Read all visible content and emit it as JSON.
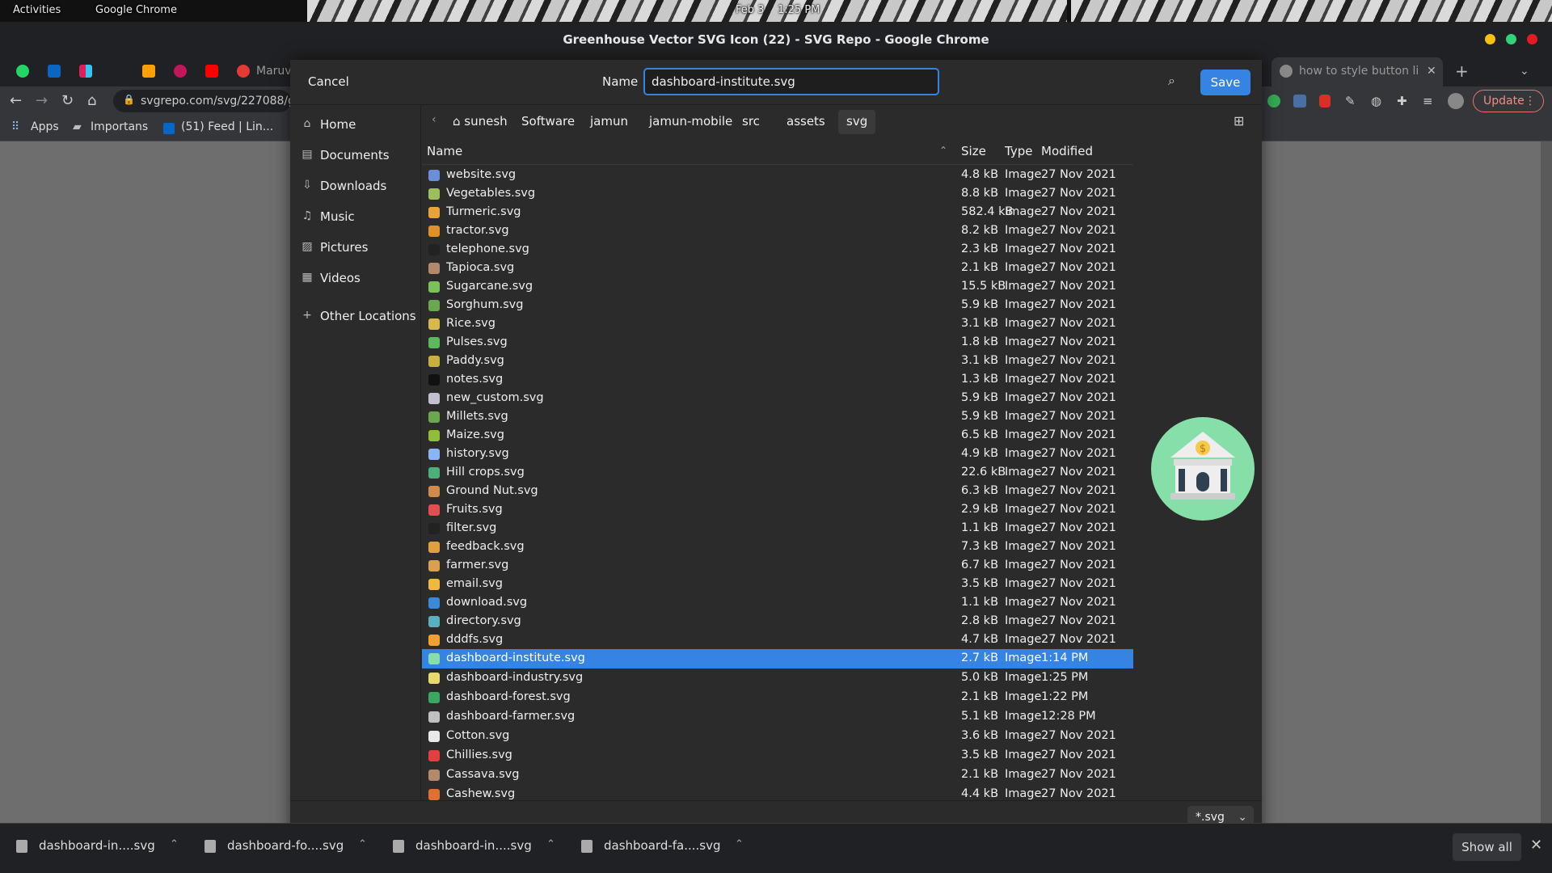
{
  "topbar": {
    "activities": "Activities",
    "app_name": "Google Chrome",
    "clock": "Feb 3",
    "clock_time": "1:25 PM"
  },
  "window": {
    "title": "Greenhouse Vector SVG Icon (22) - SVG Repo - Google Chrome"
  },
  "tabs": {
    "left_tab_text": "Maruv",
    "right_tab_text": "how to style button li",
    "new_tab": "+",
    "close": "✕"
  },
  "toolbar": {
    "url": "svgrepo.com/svg/227088/gre",
    "update_label": "Update"
  },
  "bookmarks": {
    "apps": "Apps",
    "important": "Importans",
    "feed": "(51) Feed | Lin..."
  },
  "dialog": {
    "cancel_label": "Cancel",
    "name_label": "Name",
    "name_value": "dashboard-institute.svg",
    "save_label": "Save",
    "sidebar": [
      {
        "icon": "home-icon",
        "glyph": "⌂",
        "label": "Home"
      },
      {
        "icon": "documents-icon",
        "glyph": "▤",
        "label": "Documents"
      },
      {
        "icon": "downloads-icon",
        "glyph": "⇩",
        "label": "Downloads"
      },
      {
        "icon": "music-icon",
        "glyph": "♫",
        "label": "Music"
      },
      {
        "icon": "pictures-icon",
        "glyph": "▨",
        "label": "Pictures"
      },
      {
        "icon": "videos-icon",
        "glyph": "▦",
        "label": "Videos"
      },
      {
        "icon": "other-locations-icon",
        "glyph": "+",
        "label": "Other Locations"
      }
    ],
    "path": [
      "sunesh",
      "Software",
      "jamun",
      "jamun-mobile",
      "src",
      "assets",
      "svg"
    ],
    "columns": {
      "name": "Name",
      "size": "Size",
      "type": "Type",
      "modified": "Modified"
    },
    "files": [
      {
        "name": "website.svg",
        "size": "4.8 kB",
        "type": "Image",
        "modified": "27 Nov 2021",
        "color": "#6a8fd8"
      },
      {
        "name": "Vegetables.svg",
        "size": "8.8 kB",
        "type": "Image",
        "modified": "27 Nov 2021",
        "color": "#9bbf5a"
      },
      {
        "name": "Turmeric.svg",
        "size": "582.4 kB",
        "type": "Image",
        "modified": "27 Nov 2021",
        "color": "#e8a33a"
      },
      {
        "name": "tractor.svg",
        "size": "8.2 kB",
        "type": "Image",
        "modified": "27 Nov 2021",
        "color": "#e0902a"
      },
      {
        "name": "telephone.svg",
        "size": "2.3 kB",
        "type": "Image",
        "modified": "27 Nov 2021",
        "color": "#222222"
      },
      {
        "name": "Tapioca.svg",
        "size": "2.1 kB",
        "type": "Image",
        "modified": "27 Nov 2021",
        "color": "#b08a6a"
      },
      {
        "name": "Sugarcane.svg",
        "size": "15.5 kB",
        "type": "Image",
        "modified": "27 Nov 2021",
        "color": "#7cc05a"
      },
      {
        "name": "Sorghum.svg",
        "size": "5.9 kB",
        "type": "Image",
        "modified": "27 Nov 2021",
        "color": "#6aa84f"
      },
      {
        "name": "Rice.svg",
        "size": "3.1 kB",
        "type": "Image",
        "modified": "27 Nov 2021",
        "color": "#d9b84a"
      },
      {
        "name": "Pulses.svg",
        "size": "1.8 kB",
        "type": "Image",
        "modified": "27 Nov 2021",
        "color": "#5cb85c"
      },
      {
        "name": "Paddy.svg",
        "size": "3.1 kB",
        "type": "Image",
        "modified": "27 Nov 2021",
        "color": "#c8b040"
      },
      {
        "name": "notes.svg",
        "size": "1.3 kB",
        "type": "Image",
        "modified": "27 Nov 2021",
        "color": "#111111"
      },
      {
        "name": "new_custom.svg",
        "size": "5.9 kB",
        "type": "Image",
        "modified": "27 Nov 2021",
        "color": "#c0c0d0"
      },
      {
        "name": "Millets.svg",
        "size": "5.9 kB",
        "type": "Image",
        "modified": "27 Nov 2021",
        "color": "#6aa84f"
      },
      {
        "name": "Maize.svg",
        "size": "6.5 kB",
        "type": "Image",
        "modified": "27 Nov 2021",
        "color": "#8fbf3a"
      },
      {
        "name": "history.svg",
        "size": "4.9 kB",
        "type": "Image",
        "modified": "27 Nov 2021",
        "color": "#8ab4f8"
      },
      {
        "name": "Hill crops.svg",
        "size": "22.6 kB",
        "type": "Image",
        "modified": "27 Nov 2021",
        "color": "#4caf7a"
      },
      {
        "name": "Ground Nut.svg",
        "size": "6.3 kB",
        "type": "Image",
        "modified": "27 Nov 2021",
        "color": "#d08a4a"
      },
      {
        "name": "Fruits.svg",
        "size": "2.9 kB",
        "type": "Image",
        "modified": "27 Nov 2021",
        "color": "#e05050"
      },
      {
        "name": "filter.svg",
        "size": "1.1 kB",
        "type": "Image",
        "modified": "27 Nov 2021",
        "color": "#222222"
      },
      {
        "name": "feedback.svg",
        "size": "7.3 kB",
        "type": "Image",
        "modified": "27 Nov 2021",
        "color": "#e0a040"
      },
      {
        "name": "farmer.svg",
        "size": "6.7 kB",
        "type": "Image",
        "modified": "27 Nov 2021",
        "color": "#d8a050"
      },
      {
        "name": "email.svg",
        "size": "3.5 kB",
        "type": "Image",
        "modified": "27 Nov 2021",
        "color": "#f0b840"
      },
      {
        "name": "download.svg",
        "size": "1.1 kB",
        "type": "Image",
        "modified": "27 Nov 2021",
        "color": "#3a8ad8"
      },
      {
        "name": "directory.svg",
        "size": "2.8 kB",
        "type": "Image",
        "modified": "27 Nov 2021",
        "color": "#5ab0c0"
      },
      {
        "name": "dddfs.svg",
        "size": "4.7 kB",
        "type": "Image",
        "modified": "27 Nov 2021",
        "color": "#f0a030"
      },
      {
        "name": "dashboard-institute.svg",
        "size": "2.7 kB",
        "type": "Image",
        "modified": "1:14 PM",
        "color": "#86dfa8",
        "selected": true
      },
      {
        "name": "dashboard-industry.svg",
        "size": "5.0 kB",
        "type": "Image",
        "modified": "1:25 PM",
        "color": "#e8d870"
      },
      {
        "name": "dashboard-forest.svg",
        "size": "2.1 kB",
        "type": "Image",
        "modified": "1:22 PM",
        "color": "#3aa860"
      },
      {
        "name": "dashboard-farmer.svg",
        "size": "5.1 kB",
        "type": "Image",
        "modified": "12:28 PM",
        "color": "#c0c0c0"
      },
      {
        "name": "Cotton.svg",
        "size": "3.6 kB",
        "type": "Image",
        "modified": "27 Nov 2021",
        "color": "#e8e8e8"
      },
      {
        "name": "Chillies.svg",
        "size": "3.5 kB",
        "type": "Image",
        "modified": "27 Nov 2021",
        "color": "#e04040"
      },
      {
        "name": "Cassava.svg",
        "size": "2.1 kB",
        "type": "Image",
        "modified": "27 Nov 2021",
        "color": "#b08a6a"
      },
      {
        "name": "Cashew.svg",
        "size": "4.4 kB",
        "type": "Image",
        "modified": "27 Nov 2021",
        "color": "#e07030"
      }
    ],
    "filter_value": "*.svg"
  },
  "downloads": [
    {
      "name": "dashboard-in....svg"
    },
    {
      "name": "dashboard-fo....svg"
    },
    {
      "name": "dashboard-in....svg"
    },
    {
      "name": "dashboard-fa....svg"
    }
  ],
  "downloads_show_all": "Show all",
  "colors": {
    "accent": "#3584e4",
    "dialog_bg": "#2b2b2b",
    "chrome_bg": "#202124"
  }
}
